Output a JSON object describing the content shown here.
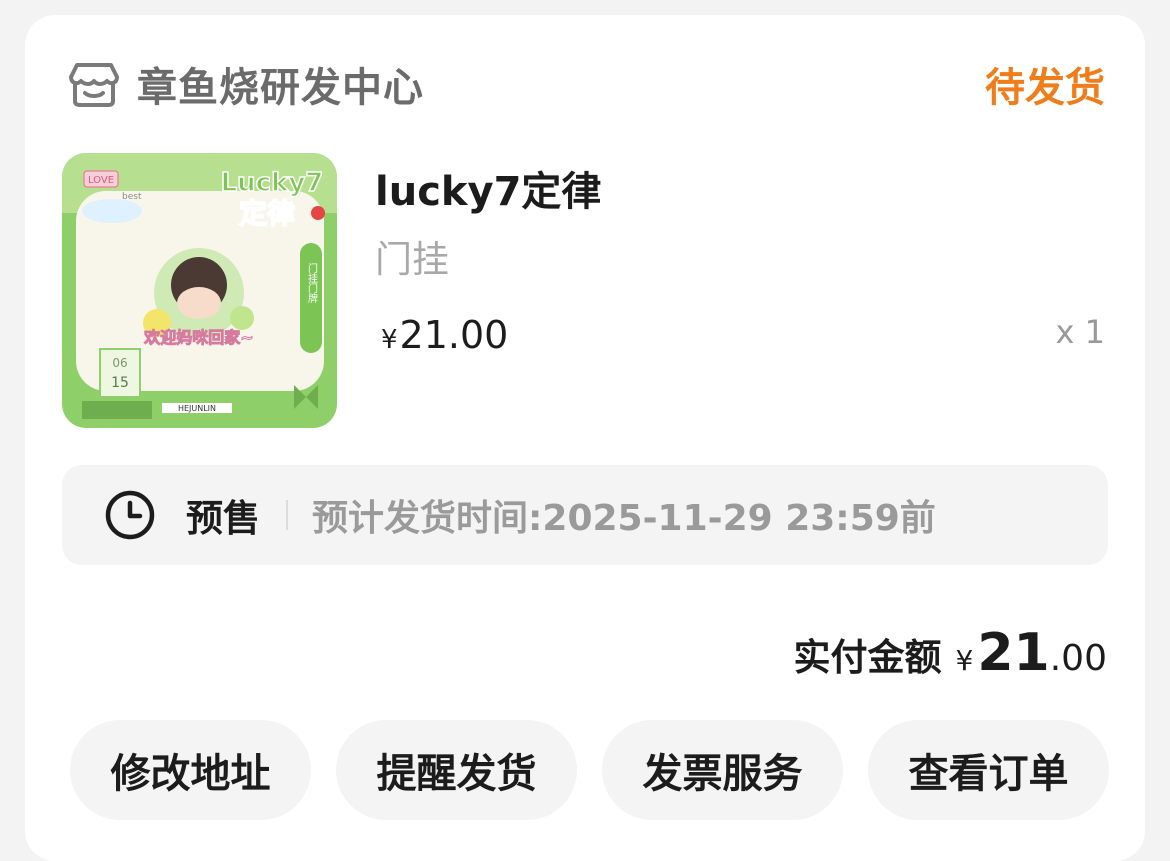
{
  "shop": {
    "name": "章鱼烧研发中心",
    "icon": "shop-icon"
  },
  "order_status": "待发货",
  "product": {
    "title": "lucky7定律",
    "subtitle": "门挂",
    "price_currency": "¥",
    "price": "21.00",
    "quantity": "x 1",
    "image": {
      "badge_love": "LOVE",
      "badge_best": "best",
      "title_text": "Lucky7",
      "title_cn": "定律",
      "side_tag": "门挂门牌",
      "welcome_text": "欢迎妈咪回家~",
      "date_top": "06",
      "date_bottom": "15",
      "name_tag": "HEJUNLIN"
    }
  },
  "presale": {
    "icon": "clock-icon",
    "label": "预售",
    "text": "预计发货时间:2025-11-29 23:59前"
  },
  "total": {
    "label": "实付金额",
    "currency": "¥",
    "integer": "21",
    "decimal": ".00"
  },
  "actions": [
    {
      "label": "修改地址"
    },
    {
      "label": "提醒发货"
    },
    {
      "label": "发票服务"
    },
    {
      "label": "查看订单"
    }
  ],
  "colors": {
    "accent": "#f07d1b",
    "background": "#f3f3f3",
    "card": "#ffffff"
  }
}
